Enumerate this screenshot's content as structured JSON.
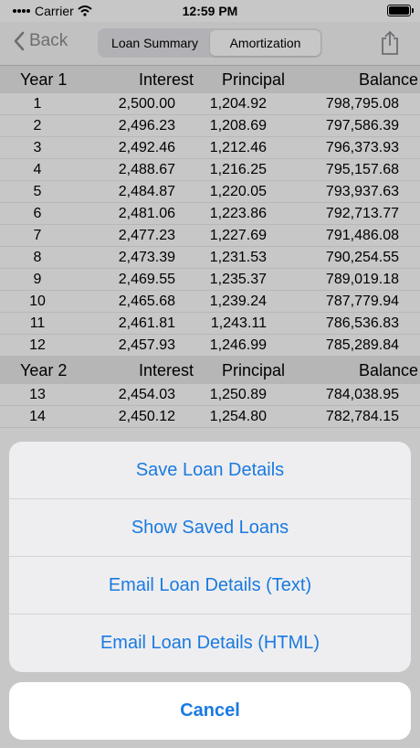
{
  "status_bar": {
    "carrier": "Carrier",
    "time": "12:59 PM"
  },
  "navbar": {
    "back_label": "Back",
    "segments": [
      {
        "label": "Loan Summary"
      },
      {
        "label": "Amortization"
      }
    ],
    "active_segment": "Amortization"
  },
  "table": {
    "year1_header": {
      "year": "Year 1",
      "interest": "Interest",
      "principal": "Principal",
      "balance": "Balance"
    },
    "year1_rows": [
      {
        "n": "1",
        "interest": "2,500.00",
        "principal": "1,204.92",
        "balance": "798,795.08"
      },
      {
        "n": "2",
        "interest": "2,496.23",
        "principal": "1,208.69",
        "balance": "797,586.39"
      },
      {
        "n": "3",
        "interest": "2,492.46",
        "principal": "1,212.46",
        "balance": "796,373.93"
      },
      {
        "n": "4",
        "interest": "2,488.67",
        "principal": "1,216.25",
        "balance": "795,157.68"
      },
      {
        "n": "5",
        "interest": "2,484.87",
        "principal": "1,220.05",
        "balance": "793,937.63"
      },
      {
        "n": "6",
        "interest": "2,481.06",
        "principal": "1,223.86",
        "balance": "792,713.77"
      },
      {
        "n": "7",
        "interest": "2,477.23",
        "principal": "1,227.69",
        "balance": "791,486.08"
      },
      {
        "n": "8",
        "interest": "2,473.39",
        "principal": "1,231.53",
        "balance": "790,254.55"
      },
      {
        "n": "9",
        "interest": "2,469.55",
        "principal": "1,235.37",
        "balance": "789,019.18"
      },
      {
        "n": "10",
        "interest": "2,465.68",
        "principal": "1,239.24",
        "balance": "787,779.94"
      },
      {
        "n": "11",
        "interest": "2,461.81",
        "principal": "1,243.11",
        "balance": "786,536.83"
      },
      {
        "n": "12",
        "interest": "2,457.93",
        "principal": "1,246.99",
        "balance": "785,289.84"
      }
    ],
    "year2_header": {
      "year": "Year 2",
      "interest": "Interest",
      "principal": "Principal",
      "balance": "Balance"
    },
    "year2_rows": [
      {
        "n": "13",
        "interest": "2,454.03",
        "principal": "1,250.89",
        "balance": "784,038.95"
      },
      {
        "n": "14",
        "interest": "2,450.12",
        "principal": "1,254.80",
        "balance": "782,784.15"
      }
    ]
  },
  "action_sheet": {
    "actions": [
      {
        "label": "Save Loan Details"
      },
      {
        "label": "Show Saved Loans"
      },
      {
        "label": "Email Loan Details (Text)"
      },
      {
        "label": "Email Loan Details (HTML)"
      }
    ],
    "cancel_label": "Cancel"
  },
  "colors": {
    "accent": "#1a7ae0",
    "header_bg": "#e9e9eb"
  },
  "icons": {
    "back": "chevron-left-icon",
    "share": "share-icon",
    "wifi": "wifi-icon",
    "battery": "battery-icon"
  }
}
